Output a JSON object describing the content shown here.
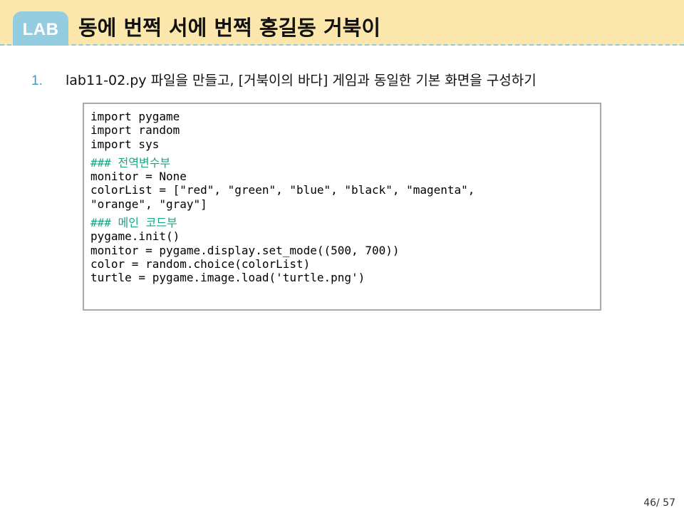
{
  "header": {
    "badge": "LAB",
    "title": "동에 번쩍 서에 번쩍 홍길동 거북이"
  },
  "step": {
    "number": "1.",
    "text": "lab11-02.py 파일을 만들고, [거북이의 바다] 게임과 동일한 기본 화면을 구성하기"
  },
  "code": {
    "lines": [
      "import pygame",
      "import random",
      "import sys",
      "",
      "### 전역변수부",
      "monitor = None",
      "colorList = [\"red\", \"green\", \"blue\", \"black\", \"magenta\",",
      "\"orange\", \"gray\"]",
      "",
      "### 메인 코드부",
      "pygame.init()",
      "monitor = pygame.display.set_mode((500, 700))",
      "color = random.choice(colorList)",
      "turtle = pygame.image.load('turtle.png')"
    ]
  },
  "footer": {
    "page": "46/ 57"
  },
  "colors": {
    "header_bg": "#fbe7ac",
    "badge_bg": "#95cde0",
    "comment": "#1aa585",
    "step_number": "#3a9ecf"
  }
}
